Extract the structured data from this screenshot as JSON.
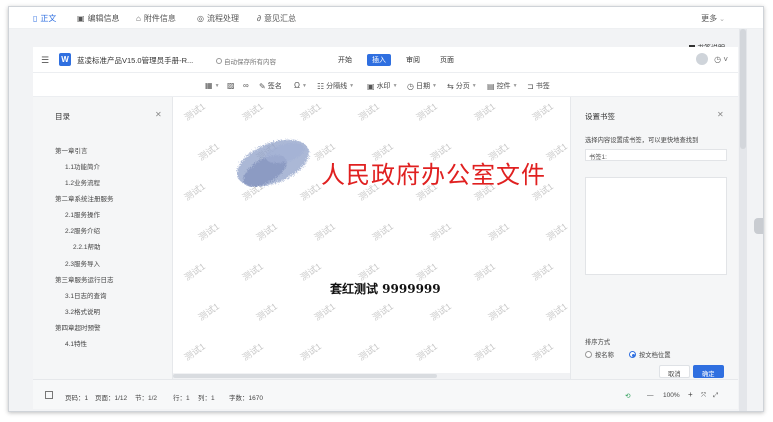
{
  "top_tabs": [
    {
      "label": "正文",
      "icon": "doc-icon",
      "active": true
    },
    {
      "label": "编辑信息",
      "icon": "edit-icon",
      "active": false
    },
    {
      "label": "附件信息",
      "icon": "attachment-icon",
      "active": false
    },
    {
      "label": "流程处理",
      "icon": "flow-icon",
      "active": false
    },
    {
      "label": "意见汇总",
      "icon": "link-icon",
      "active": false
    }
  ],
  "more_label": "更多",
  "bookmark_help": "书签说明",
  "header": {
    "title": "蓝凌标准产品V15.0管理员手册-R...",
    "autosave": "自动保存所有内容",
    "menu": [
      "开始",
      "插入",
      "审阅",
      "页面"
    ],
    "active_menu": "插入"
  },
  "toolbar": {
    "signature": "签名",
    "divider": "分隔线",
    "watermark": "水印",
    "date": "日期",
    "page_break": "分页",
    "controls": "控件",
    "bookmark": "书签"
  },
  "toc": {
    "title": "目录",
    "items": [
      {
        "label": "第一章引言",
        "level": 1
      },
      {
        "label": "1.1功能简介",
        "level": 2
      },
      {
        "label": "1.2业务流程",
        "level": 2
      },
      {
        "label": "第二章系统注册服务",
        "level": 1
      },
      {
        "label": "2.1服务操作",
        "level": 2
      },
      {
        "label": "2.2服务介绍",
        "level": 2
      },
      {
        "label": "2.2.1帮助",
        "level": 3
      },
      {
        "label": "2.3服务导入",
        "level": 2
      },
      {
        "label": "第三章服务运行日志",
        "level": 1
      },
      {
        "label": "3.1日志的查询",
        "level": 2
      },
      {
        "label": "3.2格式说明",
        "level": 2
      },
      {
        "label": "第四章超时预警",
        "level": 1
      },
      {
        "label": "4.1特性",
        "level": 2
      }
    ]
  },
  "document": {
    "red_header": "人民政府办公室文件",
    "body_text": "套红测试 9999999",
    "watermark": "测试1"
  },
  "bookmark_panel": {
    "title": "设置书签",
    "hint": "选择内容设置成书签，可以更快地查找到",
    "input_value": "书签1:",
    "sort_label": "排序方式",
    "sort_by_name": "按名称",
    "sort_by_position": "按文档位置",
    "selected_sort": "按文档位置",
    "cancel": "取消",
    "ok": "确定"
  },
  "status_bar": {
    "page_num": "页码：1",
    "pages": "页面：1/12",
    "section": "节：1/2",
    "row": "行：1",
    "col": "列：1",
    "word_count": "字数：1670",
    "zoom": "100%"
  },
  "colors": {
    "accent": "#2f6fe0",
    "red_header": "#e02020"
  }
}
